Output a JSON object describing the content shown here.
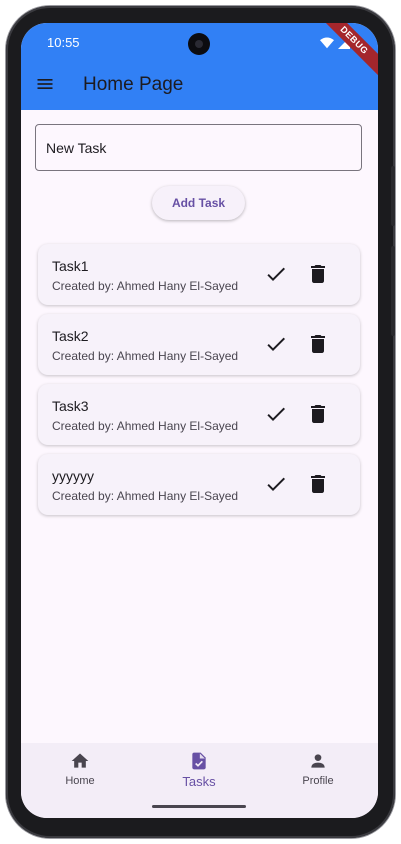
{
  "status_bar": {
    "time": "10:55",
    "debug_label": "DEBUG"
  },
  "app_bar": {
    "title": "Home Page",
    "menu_icon": "hamburger-menu-icon"
  },
  "task_form": {
    "input_value": "New Task",
    "input_placeholder": "New Task",
    "add_button_label": "Add Task"
  },
  "tasks": [
    {
      "title": "Task1",
      "created_by": "Created by: Ahmed Hany El-Sayed"
    },
    {
      "title": "Task2",
      "created_by": "Created by: Ahmed Hany El-Sayed"
    },
    {
      "title": "Task3",
      "created_by": "Created by: Ahmed Hany El-Sayed"
    },
    {
      "title": "yyyyyy",
      "created_by": "Created by: Ahmed Hany El-Sayed"
    }
  ],
  "bottom_nav": {
    "items": [
      {
        "label": "Home",
        "icon": "home-icon"
      },
      {
        "label": "Tasks",
        "icon": "task-icon"
      },
      {
        "label": "Profile",
        "icon": "person-icon"
      }
    ],
    "selected": "Tasks"
  },
  "colors": {
    "app_bar": "#3180f5",
    "accent": "#6750a4",
    "background": "#fdf7fe",
    "debug_ribbon": "#a4262c"
  }
}
